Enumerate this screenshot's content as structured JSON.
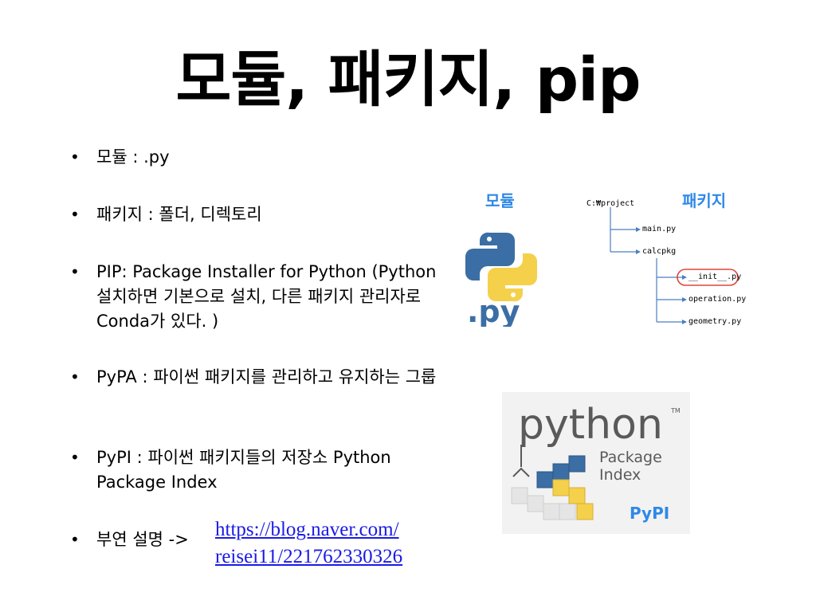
{
  "title": "모듈, 패키지, pip",
  "bullets": [
    "모듈 : .py",
    "패키지 : 폴더, 디렉토리",
    "PIP: Package Installer for Python (Python 설치하면 기본으로 설치, 다른 패키지 관리자로 Conda가 있다. )",
    "PyPA : 파이썬 패키지를 관리하고 유지하는 그룹",
    "PyPI : 파이썬 패키지들의 저장소 Python Package Index",
    "부연 설명 ->"
  ],
  "link": {
    "line1": "https://blog.naver.com/",
    "line2": "reisei11/221762330326"
  },
  "labels": {
    "module": "모듈",
    "package": "패키지",
    "pypi": "PyPI"
  },
  "py_logo_text": ".py",
  "tree": {
    "root": "C:₩project",
    "items": [
      "main.py",
      "calcpkg",
      "__init__.py",
      "operation.py",
      "geometry.py"
    ]
  },
  "pypi_logo": {
    "wordmark": "python",
    "tm": "TM",
    "line1": "Package",
    "line2": "Index"
  },
  "colors": {
    "accent_blue": "#2f88e8",
    "link_blue": "#1a1ae6",
    "highlight_red": "#e0463a",
    "python_blue": "#3b6ea5",
    "python_yellow": "#f5d04a"
  }
}
